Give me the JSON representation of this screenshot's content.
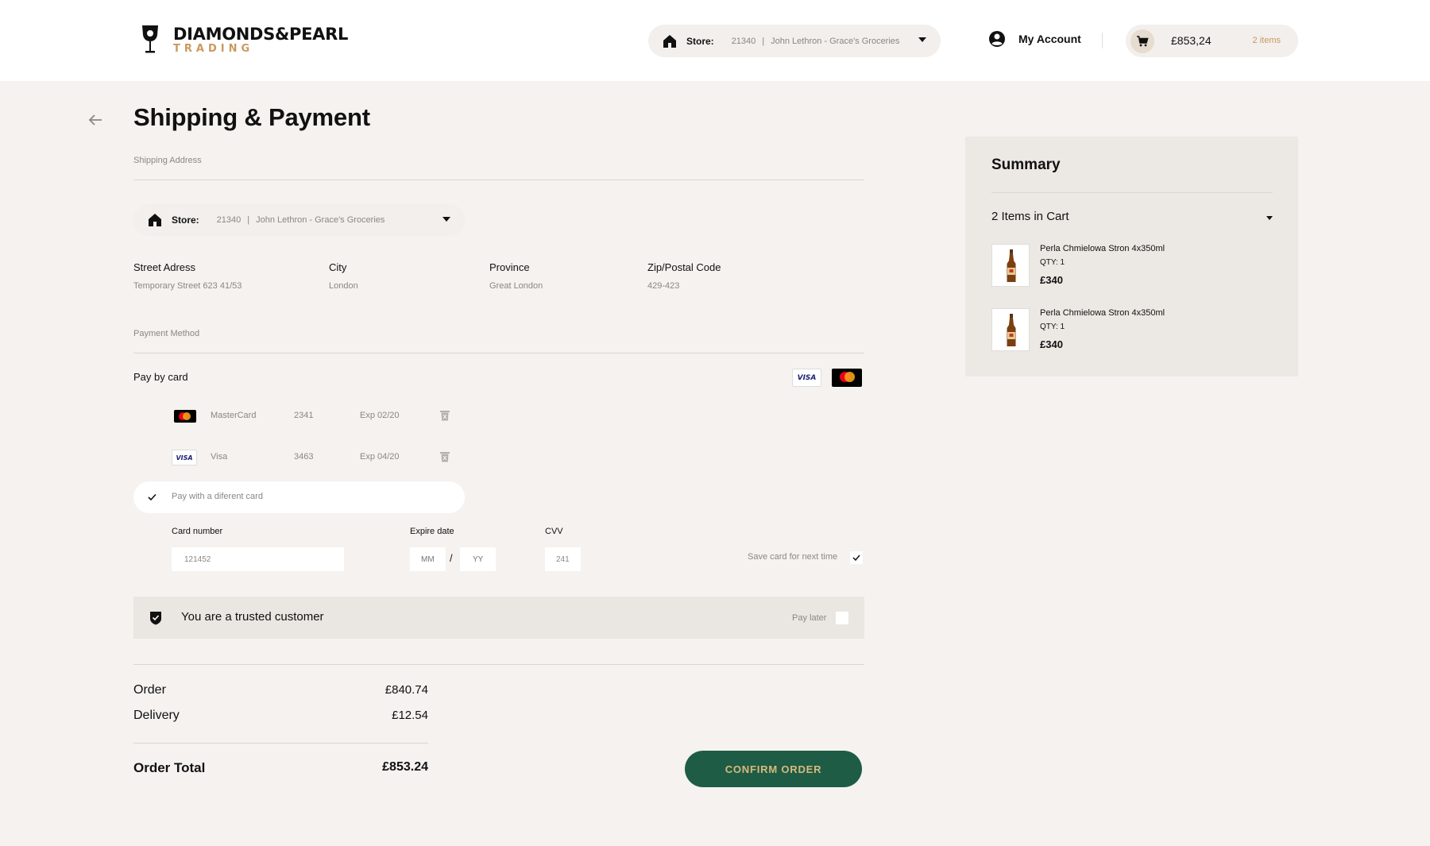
{
  "header": {
    "brand_line1": "DIAMONDS&PEARL",
    "brand_line2": "TRADING",
    "store": {
      "label": "Store:",
      "number": "21340",
      "separator": "|",
      "name": "John Lethron - Grace's Groceries"
    },
    "account_label": "My Account",
    "cart": {
      "amount": "£853,24",
      "items": "2 items"
    }
  },
  "page": {
    "title": "Shipping & Payment",
    "shipping_label": "Shipping Address",
    "store": {
      "label": "Store:",
      "number": "21340",
      "separator": "|",
      "name": "John Lethron - Grace's Groceries"
    },
    "address": [
      {
        "label": "Street Adress",
        "value": "Temporary Street 623 41/53"
      },
      {
        "label": "City",
        "value": "London"
      },
      {
        "label": "Province",
        "value": "Great London"
      },
      {
        "label": "Zip/Postal Code",
        "value": "429-423"
      }
    ],
    "payment_label": "Payment Method",
    "pay_by_card": "Pay by card",
    "visa_text": "VISA",
    "saved_cards": [
      {
        "type": "MasterCard",
        "number": "2341",
        "exp": "Exp 02/20"
      },
      {
        "type": "Visa",
        "number": "3463",
        "exp": "Exp 04/20"
      }
    ],
    "different_card": "Pay with a diferent card",
    "card_form": {
      "card_number_label": "Card number",
      "card_number_value": "121452",
      "expire_label": "Expire date",
      "mm_placeholder": "MM",
      "slash": "/",
      "yy_placeholder": "YY",
      "cvv_label": "CVV",
      "cvv_value": "241",
      "save_label": "Save card for next time",
      "save_checked": true
    },
    "trusted": {
      "text": "You are a trusted customer",
      "pay_later": "Pay later",
      "pay_later_checked": false
    },
    "totals": {
      "order_label": "Order",
      "order_value": "£840.74",
      "delivery_label": "Delivery",
      "delivery_value": "£12.54",
      "total_label": "Order Total",
      "total_value": "£853.24"
    },
    "confirm_label": "CONFIRM ORDER"
  },
  "summary": {
    "title": "Summary",
    "items_label": "2 Items in Cart",
    "products": [
      {
        "name": "Perla Chmielowa Stron 4x350ml",
        "qty": "QTY: 1",
        "price": "£340"
      },
      {
        "name": "Perla Chmielowa Stron 4x350ml",
        "qty": "QTY: 1",
        "price": "£340"
      }
    ]
  },
  "colors": {
    "accent_gold": "#c99a5e",
    "confirm_green": "#1e5c45",
    "page_bg": "#f5f2f0"
  },
  "icons": [
    "brand-glass-icon",
    "home-icon",
    "account-icon",
    "cart-icon",
    "back-arrow-icon",
    "visa-icon",
    "mastercard-icon",
    "trash-icon",
    "check-icon",
    "shield-check-icon",
    "beer-bottle-icon"
  ]
}
